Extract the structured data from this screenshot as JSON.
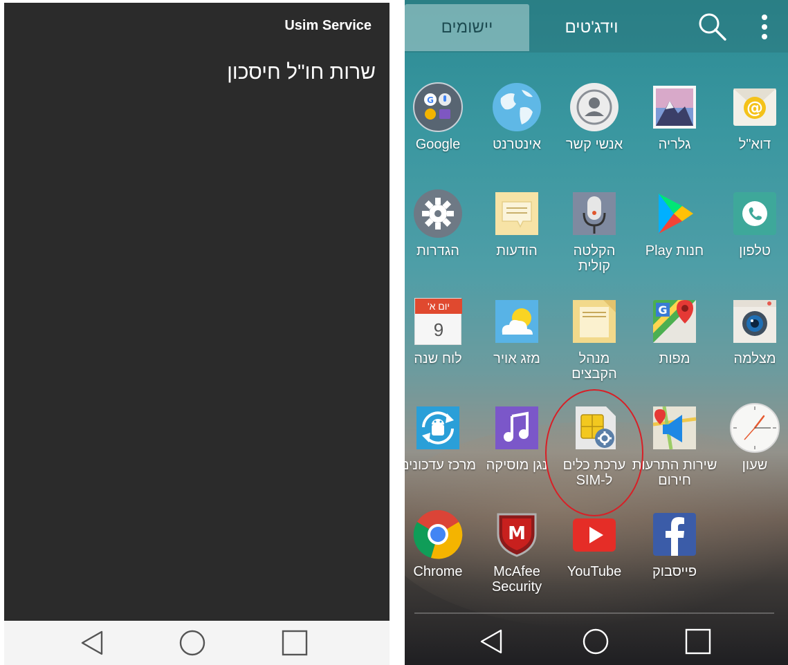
{
  "left_screen": {
    "title": "Usim Service",
    "item": "שרות חו\"ל חיסכון"
  },
  "right_screen": {
    "tabs": {
      "apps": "יישומים",
      "widgets": "וידג'טים"
    },
    "apps": [
      {
        "label": "דוא\"ל",
        "icon": "email-icon"
      },
      {
        "label": "גלריה",
        "icon": "gallery-icon"
      },
      {
        "label": "אנשי קשר",
        "icon": "contacts-icon"
      },
      {
        "label": "אינטרנט",
        "icon": "internet-icon"
      },
      {
        "label": "Google",
        "icon": "google-folder-icon"
      },
      {
        "label": "טלפון",
        "icon": "phone-icon"
      },
      {
        "label": "חנות Play",
        "icon": "play-store-icon"
      },
      {
        "label": "הקלטה",
        "label2": "קולית",
        "icon": "voice-recorder-icon"
      },
      {
        "label": "הודעות",
        "icon": "messages-icon"
      },
      {
        "label": "הגדרות",
        "icon": "settings-icon"
      },
      {
        "label": "מצלמה",
        "icon": "camera-icon"
      },
      {
        "label": "מפות",
        "icon": "maps-icon"
      },
      {
        "label": "מנהל",
        "label2": "הקבצים",
        "icon": "file-manager-icon"
      },
      {
        "label": "מזג אויר",
        "icon": "weather-icon"
      },
      {
        "label": "לוח שנה",
        "icon": "calendar-icon",
        "calendar_day": "יום א'",
        "calendar_date": "9"
      },
      {
        "label": "שעון",
        "icon": "clock-icon"
      },
      {
        "label": "שירות התרעות",
        "label2": "חירום",
        "icon": "emergency-alerts-icon"
      },
      {
        "label": "ערכת כלים",
        "label2": "ל-SIM",
        "icon": "sim-toolkit-icon"
      },
      {
        "label": "נגן מוסיקה",
        "icon": "music-player-icon"
      },
      {
        "label": "מרכז עדכונים",
        "icon": "update-center-icon"
      },
      {
        "label": "פייסבוק",
        "icon": "facebook-icon"
      },
      {
        "label": "YouTube",
        "icon": "youtube-icon"
      },
      {
        "label": "McAfee",
        "label2": "Security",
        "icon": "mcafee-icon"
      },
      {
        "label": "Chrome",
        "icon": "chrome-icon"
      }
    ]
  },
  "colors": {
    "highlight": "#d81f26",
    "left_bg": "#2b2b2b",
    "nav_bg": "#f4f4f4"
  }
}
